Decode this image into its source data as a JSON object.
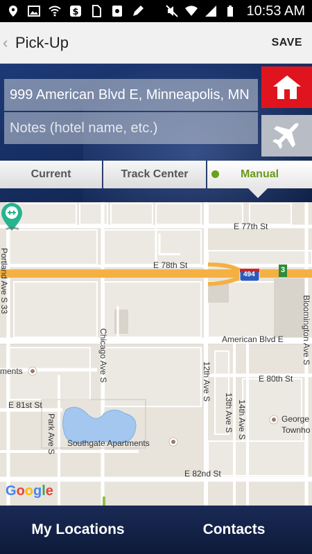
{
  "status_bar": {
    "time": "10:53 AM",
    "icons": [
      "location-icon",
      "image-icon",
      "wifi-calling-icon",
      "dollar-icon",
      "sim-icon",
      "app-icon",
      "pen-icon",
      "mute-icon",
      "wifi-icon",
      "signal-icon",
      "battery-icon"
    ]
  },
  "header": {
    "back": "‹",
    "title": "Pick-Up",
    "save_label": "SAVE"
  },
  "form": {
    "address_value": "999 American Blvd E, Minneapolis, MN",
    "notes_placeholder": "Notes (hotel name, etc.)"
  },
  "side_buttons": {
    "home": "home-icon",
    "airport": "airplane-icon",
    "home_color": "#e0141e",
    "airport_color": "#b8bcc4"
  },
  "tabs": [
    {
      "label": "Current",
      "active": false
    },
    {
      "label": "Track Center",
      "active": false
    },
    {
      "label": "Manual",
      "active": true
    }
  ],
  "map": {
    "labels": {
      "e77": "E 77th St",
      "e78": "E 78th St",
      "i494": "494",
      "exit3": "3",
      "amer": "American Blvd E",
      "e80": "E 80th St",
      "e81": "E 81st St",
      "e82": "E 82nd St",
      "southgate": "Southgate Apartments",
      "ments": "ments",
      "george": "George",
      "townho": "Townho",
      "chicago": "Chicago Ave S",
      "portland": "Portland Ave S",
      "park": "Park Ave S",
      "twelfth": "12th Ave S",
      "thirteenth": "13th Ave S",
      "fourteenth": "14th Ave S",
      "bloomington": "Bloomington Ave S",
      "ss": "33"
    },
    "attribution": "Google",
    "google_colors": [
      "#4285F4",
      "#EA4335",
      "#FBBC05",
      "#4285F4",
      "#34A853",
      "#EA4335"
    ]
  },
  "bottom_nav": {
    "locations": "My Locations",
    "contacts": "Contacts"
  }
}
